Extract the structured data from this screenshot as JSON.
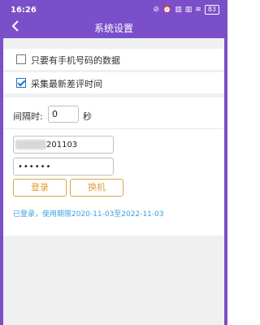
{
  "status_bar": {
    "time": "16:26",
    "icons": [
      "⊘",
      "⏰",
      "▥",
      "▥",
      "≋"
    ],
    "battery": "83"
  },
  "header": {
    "title": "系统设置"
  },
  "options": [
    {
      "label": "只要有手机号码的数据",
      "checked": false
    },
    {
      "label": "采集最新差评时间",
      "checked": true
    }
  ],
  "interval": {
    "label": "间隔时:",
    "value": "0",
    "unit": "秒"
  },
  "account": {
    "username_visible": "201103",
    "password_mask": "••••••"
  },
  "buttons": {
    "login": "登录",
    "switch": "换机"
  },
  "status_message": "已登录，使用期限2020-11-03至2022-11-03",
  "colors": {
    "header": "#7b4fc9",
    "accent_button": "#e09b34",
    "status_text": "#3aa0e0"
  }
}
